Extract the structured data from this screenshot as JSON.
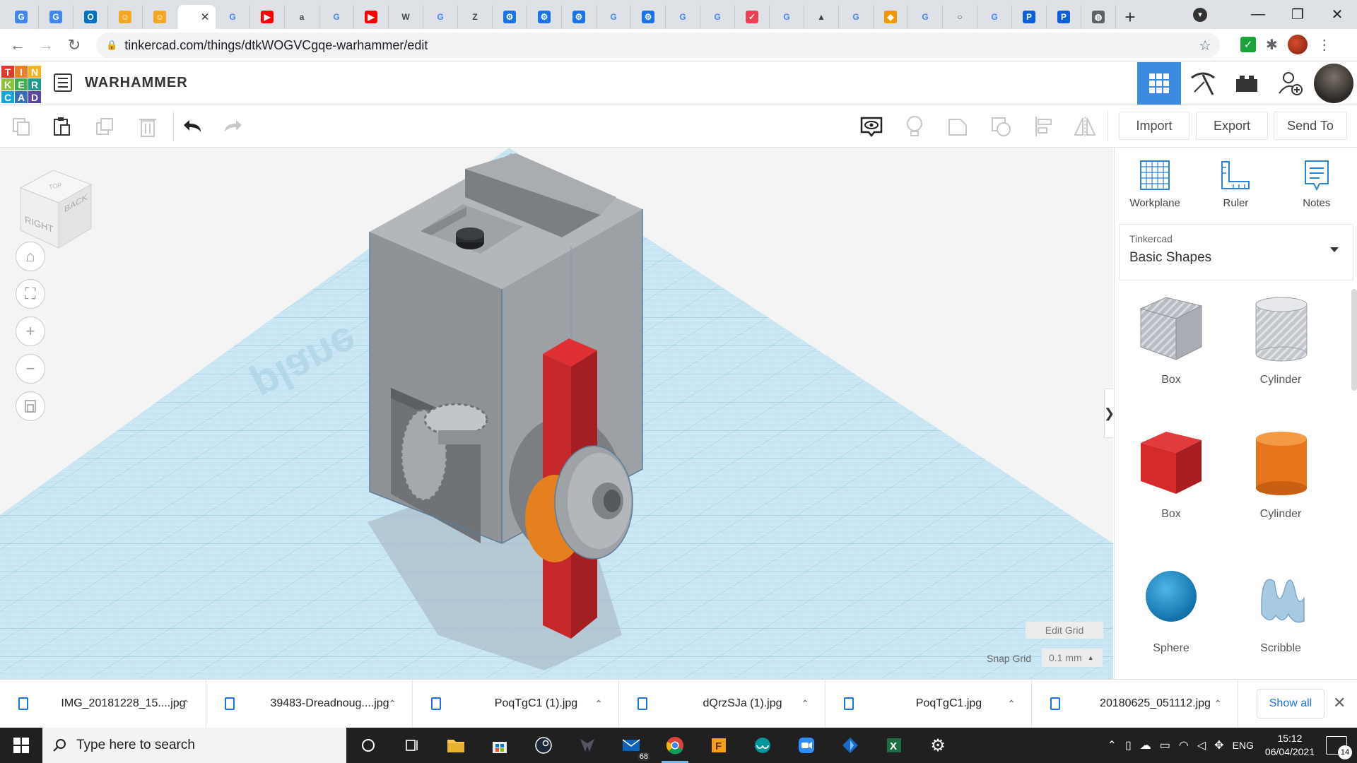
{
  "browser": {
    "tabs": [
      {
        "icon": "google-docs-icon",
        "color": "#4285f4",
        "glyph": "G"
      },
      {
        "icon": "google-docs-icon",
        "color": "#4285f4",
        "glyph": "G"
      },
      {
        "icon": "outlook-icon",
        "color": "#0072c6",
        "glyph": "O"
      },
      {
        "icon": "helper-icon",
        "color": "#f5a623",
        "glyph": "☺"
      },
      {
        "icon": "helper-icon",
        "color": "#f5a623",
        "glyph": "☺"
      },
      {
        "icon": "tinkercad-icon",
        "color": "#ffffff",
        "glyph": ""
      },
      {
        "icon": "google-icon",
        "color": "#ffffff",
        "glyph": "G"
      },
      {
        "icon": "youtube-icon",
        "color": "#ff0000",
        "glyph": "▶"
      },
      {
        "icon": "amazon-icon",
        "color": "#ffffff",
        "glyph": "a"
      },
      {
        "icon": "google-icon",
        "color": "#ffffff",
        "glyph": "G"
      },
      {
        "icon": "youtube-icon",
        "color": "#ff0000",
        "glyph": "▶"
      },
      {
        "icon": "wikipedia-icon",
        "color": "#ffffff",
        "glyph": "W"
      },
      {
        "icon": "google-icon",
        "color": "#ffffff",
        "glyph": "G"
      },
      {
        "icon": "z-icon",
        "color": "#ffffff",
        "glyph": "Z"
      },
      {
        "icon": "settings-icon",
        "color": "#1a73e8",
        "glyph": "⚙"
      },
      {
        "icon": "settings-icon",
        "color": "#1a73e8",
        "glyph": "⚙"
      },
      {
        "icon": "settings-icon",
        "color": "#1a73e8",
        "glyph": "⚙"
      },
      {
        "icon": "google-icon",
        "color": "#ffffff",
        "glyph": "G"
      },
      {
        "icon": "settings-icon",
        "color": "#1a73e8",
        "glyph": "⚙"
      },
      {
        "icon": "google-icon",
        "color": "#ffffff",
        "glyph": "G"
      },
      {
        "icon": "google-icon",
        "color": "#ffffff",
        "glyph": "G"
      },
      {
        "icon": "pocket-icon",
        "color": "#ef3f56",
        "glyph": "✓"
      },
      {
        "icon": "google-icon",
        "color": "#ffffff",
        "glyph": "G"
      },
      {
        "icon": "chart-icon",
        "color": "#ffffff",
        "glyph": "▲"
      },
      {
        "icon": "google-icon",
        "color": "#ffffff",
        "glyph": "G"
      },
      {
        "icon": "app-icon",
        "color": "#f29900",
        "glyph": "◆"
      },
      {
        "icon": "google-icon",
        "color": "#ffffff",
        "glyph": "G"
      },
      {
        "icon": "circle-icon",
        "color": "#ffffff",
        "glyph": "○"
      },
      {
        "icon": "google-icon",
        "color": "#ffffff",
        "glyph": "G"
      },
      {
        "icon": "pic-icon",
        "color": "#0b5ed7",
        "glyph": "P"
      },
      {
        "icon": "pic-icon",
        "color": "#0b5ed7",
        "glyph": "P"
      },
      {
        "icon": "globe-icon",
        "color": "#5f6368",
        "glyph": "◍"
      }
    ],
    "url": "tinkercad.com/things/dtkWOGVCgqe-warhammer/edit"
  },
  "app": {
    "logo_letters": [
      "T",
      "I",
      "N",
      "K",
      "E",
      "R",
      "C",
      "A",
      "D"
    ],
    "logo_colors": [
      "#e2382b",
      "#ee7d28",
      "#f5b323",
      "#8cc43f",
      "#3bb04b",
      "#1a9b8e",
      "#17a5dc",
      "#3a6fc0",
      "#5b47a6"
    ],
    "project_title": "WARHAMMER",
    "accent": "#3a8be0"
  },
  "toolbar": {
    "import_label": "Import",
    "export_label": "Export",
    "sendto_label": "Send To"
  },
  "viewport": {
    "cube_right": "RIGHT",
    "cube_back": "BACK",
    "cube_top": "TOP",
    "workplane_watermark": "plane",
    "edit_grid_label": "Edit Grid",
    "snap_grid_label": "Snap Grid",
    "snap_grid_value": "0.1 mm"
  },
  "panel": {
    "tools": [
      {
        "label": "Workplane"
      },
      {
        "label": "Ruler"
      },
      {
        "label": "Notes"
      }
    ],
    "library_small": "Tinkercad",
    "library_big": "Basic Shapes",
    "shapes": [
      {
        "label": "Box",
        "kind": "box-hole",
        "color": "#b0b4bb"
      },
      {
        "label": "Cylinder",
        "kind": "cylinder-hole",
        "color": "#b8bdc4"
      },
      {
        "label": "Box",
        "kind": "box",
        "color": "#d42a2a"
      },
      {
        "label": "Cylinder",
        "kind": "cylinder",
        "color": "#e8741b"
      },
      {
        "label": "Sphere",
        "kind": "sphere",
        "color": "#1a8fcf"
      },
      {
        "label": "Scribble",
        "kind": "scribble",
        "color": "#9ec3e0"
      }
    ]
  },
  "downloads": {
    "items": [
      "IMG_20181228_15....jpg",
      "39483-Dreadnoug....jpg",
      "PoqTgC1 (1).jpg",
      "dQrzSJa (1).jpg",
      "PoqTgC1.jpg",
      "20180625_051112.jpg"
    ],
    "show_all": "Show all"
  },
  "taskbar": {
    "search_placeholder": "Type here to search",
    "mail_badge": "68",
    "language": "ENG",
    "time": "15:12",
    "date": "06/04/2021",
    "notif_count": "14"
  }
}
